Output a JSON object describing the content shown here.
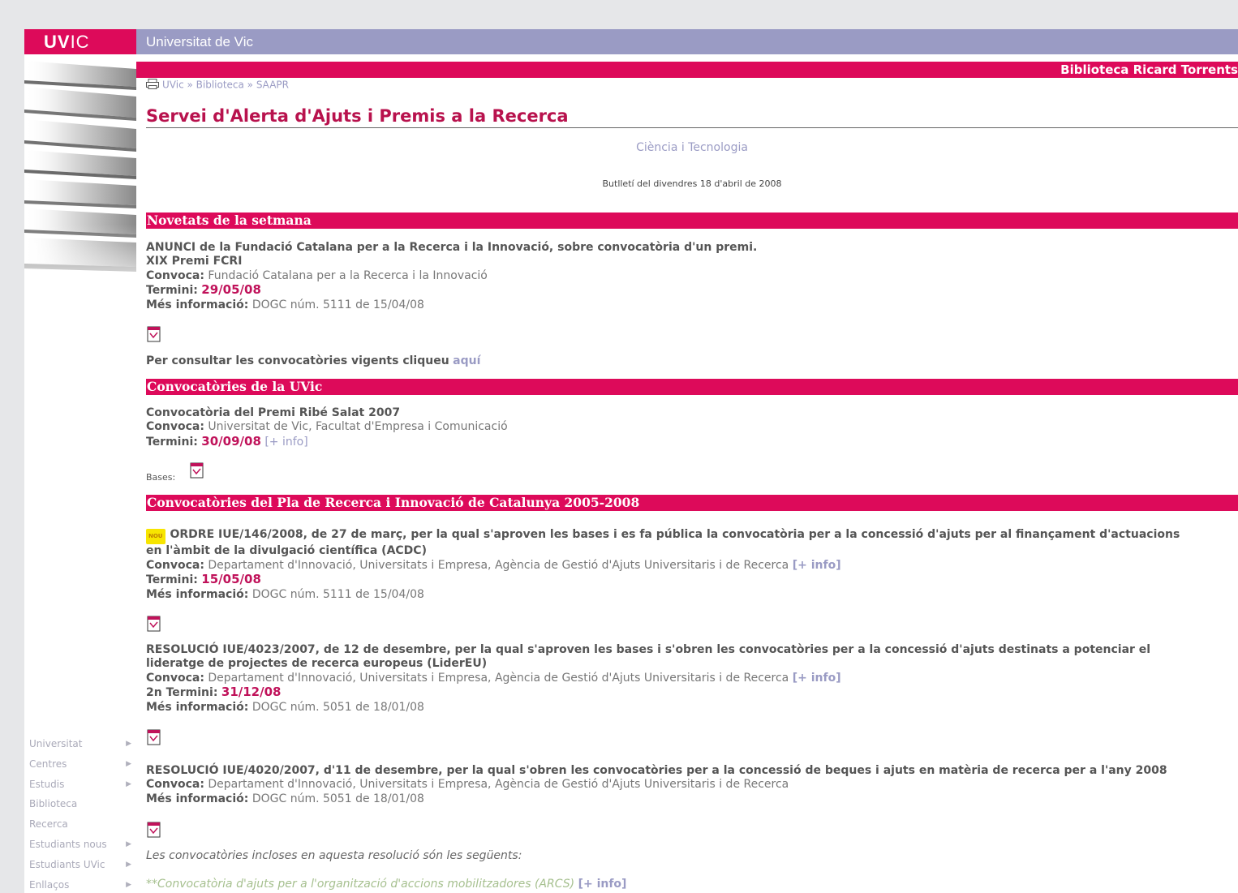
{
  "header": {
    "logo_bold": "UV",
    "logo_light": "IC",
    "site_title": "Universitat de Vic",
    "library_name": "Biblioteca Ricard Torrents"
  },
  "breadcrumb": {
    "text": "UVic » Biblioteca » SAAPR"
  },
  "page": {
    "title": "Servei d'Alerta d'Ajuts i Premis a la Recerca",
    "subtitle": "Ciència i Tecnologia",
    "bulletin": "Butlletí del divendres 18 d'abril de 2008"
  },
  "labels": {
    "convoca": "Convoca:",
    "termini": "Termini:",
    "termini2": "2n Termini:",
    "mes_info": "Més informació:",
    "plus_info": "[+ info]",
    "bases": "Bases:",
    "nou": "NOU"
  },
  "sections": {
    "novetats": {
      "heading": "Novetats de la setmana",
      "line1": "ANUNCI de la Fundació Catalana per a la Recerca i la Innovació, sobre convocatòria d'un premi.",
      "line2": "XIX Premi FCRI",
      "convoca": "Fundació Catalana per a la Recerca i la Innovació",
      "termini": "29/05/08",
      "mes_info": "DOGC núm. 5111 de 15/04/08",
      "consult_text": "Per consultar les convocatòries vigents cliqueu",
      "consult_link": "aquí"
    },
    "uvic": {
      "heading": "Convocatòries de la UVic",
      "title": "Convocatòria del Premi Ribé Salat 2007",
      "convoca": "Universitat de Vic, Facultat d'Empresa i Comunicació",
      "termini": "30/09/08"
    },
    "pla": {
      "heading": "Convocatòries del Pla de Recerca i Innovació de Catalunya 2005-2008",
      "item1": {
        "line1": "ORDRE IUE/146/2008, de 27 de març, per la qual s'aproven les bases i es fa pública la convocatòria per a la concessió d'ajuts per al finançament d'actuacions",
        "line2": "en l'àmbit de la divulgació científica (ACDC)",
        "convoca": "Departament d'Innovació, Universitats i Empresa, Agència de Gestió d'Ajuts Universitaris i de Recerca",
        "termini": "15/05/08",
        "mes_info": "DOGC núm. 5111 de 15/04/08"
      },
      "item2": {
        "line1": "RESOLUCIÓ IUE/4023/2007, de 12 de desembre, per la qual s'aproven les bases i s'obren les convocatòries per a la concessió d'ajuts destinats a potenciar el",
        "line2": "lideratge de projectes de recerca europeus (LiderEU)",
        "convoca": "Departament d'Innovació, Universitats i Empresa, Agència de Gestió d'Ajuts Universitaris i de Recerca",
        "termini": "31/12/08",
        "mes_info": "DOGC núm. 5051 de 18/01/08"
      },
      "item3": {
        "line1": "RESOLUCIÓ IUE/4020/2007, d'11 de desembre, per la qual s'obren les convocatòries per a la concessió de beques i ajuts en matèria de recerca per a l'any 2008",
        "convoca": "Departament d'Innovació, Universitats i Empresa, Agència de Gestió d'Ajuts Universitaris i de Recerca",
        "mes_info": "DOGC núm. 5051 de 18/01/08",
        "included_note": "Les convocatòries incloses en aquesta resolució són les següents:",
        "sub_item": "**Convocatòria d'ajuts per a l'organització d'accions mobilitzadores (ARCS)"
      }
    }
  },
  "sidebar": {
    "items": [
      {
        "label": "Universitat",
        "arrow": "▶"
      },
      {
        "label": "Centres",
        "arrow": "▶"
      },
      {
        "label": "Estudis",
        "arrow": "▶"
      },
      {
        "label": "Biblioteca",
        "arrow": ""
      },
      {
        "label": "Recerca",
        "arrow": ""
      },
      {
        "label": "Estudiants nous",
        "arrow": "▶"
      },
      {
        "label": "Estudiants UVic",
        "arrow": "▶"
      },
      {
        "label": "Enllaços",
        "arrow": "▶"
      }
    ]
  },
  "colors": {
    "brand_magenta": "#dd0a5a",
    "brand_lavender": "#9a9bc4",
    "date_red": "#c0125a"
  }
}
